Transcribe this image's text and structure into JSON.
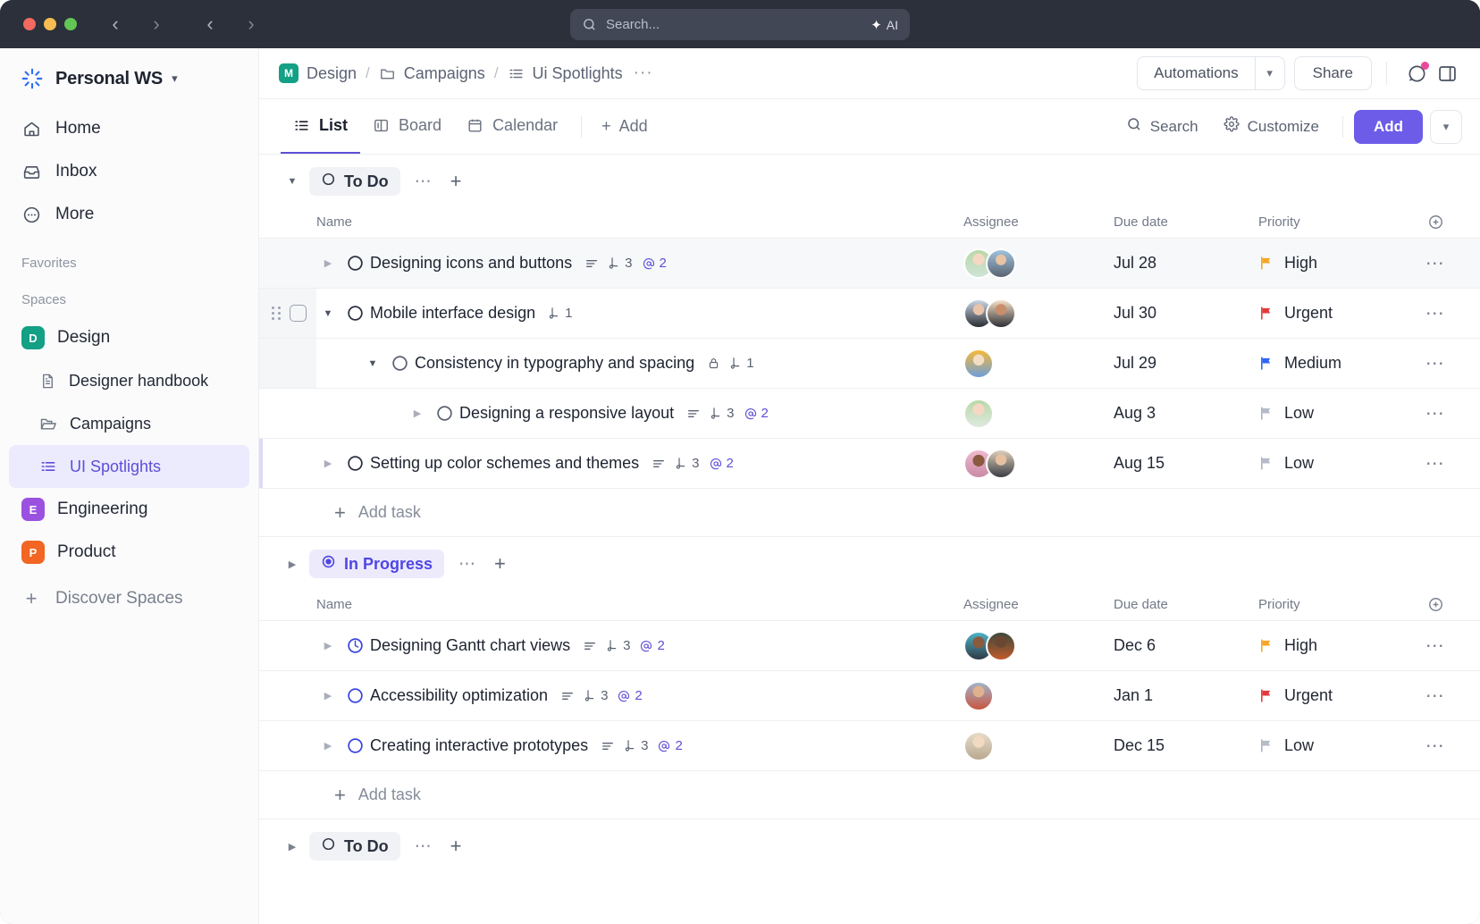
{
  "titlebar": {
    "search_placeholder": "Search...",
    "ai_label": "AI"
  },
  "sidebar": {
    "workspace": "Personal WS",
    "nav": [
      {
        "label": "Home",
        "icon": "home-icon"
      },
      {
        "label": "Inbox",
        "icon": "inbox-icon"
      },
      {
        "label": "More",
        "icon": "more-circle-icon"
      }
    ],
    "favorites_label": "Favorites",
    "spaces_label": "Spaces",
    "spaces": [
      {
        "label": "Design",
        "badge": "D",
        "color": "#13a085"
      },
      {
        "label": "Engineering",
        "badge": "E",
        "color": "#9b51e0"
      },
      {
        "label": "Product",
        "badge": "P",
        "color": "#f26522"
      }
    ],
    "design_children": [
      {
        "label": "Designer handbook",
        "icon": "doc-icon"
      },
      {
        "label": "Campaigns",
        "icon": "folder-open-icon"
      }
    ],
    "active_list": "UI Spotlights",
    "discover_label": "Discover Spaces"
  },
  "header": {
    "breadcrumb": [
      {
        "label": "Design",
        "badge": "M",
        "icon": "space-badge"
      },
      {
        "label": "Campaigns",
        "icon": "folder-icon"
      },
      {
        "label": "Ui Spotlights",
        "icon": "list-icon"
      }
    ],
    "separator": "/",
    "overflow": "···",
    "automations_label": "Automations",
    "share_label": "Share"
  },
  "viewbar": {
    "tabs": [
      {
        "label": "List",
        "icon": "list-icon",
        "active": true
      },
      {
        "label": "Board",
        "icon": "board-icon",
        "active": false
      },
      {
        "label": "Calendar",
        "icon": "calendar-icon",
        "active": false
      }
    ],
    "add_view_label": "Add",
    "search_label": "Search",
    "customize_label": "Customize",
    "add_label": "Add"
  },
  "columns": {
    "name": "Name",
    "assignee": "Assignee",
    "due_date": "Due date",
    "priority": "Priority"
  },
  "accent": "#6c5ce7",
  "groups": [
    {
      "status": "To Do",
      "status_type": "todo",
      "expanded": true,
      "add_task_label": "Add task",
      "tasks": [
        {
          "name": "Designing icons and buttons",
          "indent": 0,
          "status_icon": "circle-open",
          "has_description": true,
          "subtask_count": "3",
          "mention_count": "2",
          "locked": false,
          "expandable": true,
          "expanded": false,
          "assignees": [
            "#c9e2d2",
            "#7f94ae"
          ],
          "due_date": "Jul 28",
          "priority": "High",
          "priority_color": "#f5a623",
          "highlight": true
        },
        {
          "name": "Mobile interface design",
          "indent": 0,
          "status_icon": "circle-open",
          "has_description": false,
          "subtask_count": "1",
          "mention_count": "",
          "locked": false,
          "expandable": true,
          "expanded": true,
          "assignees": [
            "#cbd6e4",
            "#f2ddc9"
          ],
          "due_date": "Jul 30",
          "priority": "Urgent",
          "priority_color": "#e5383b",
          "highlight": false
        },
        {
          "name": "Consistency in typography and spacing",
          "indent": 1,
          "status_icon": "circle-open",
          "has_description": false,
          "subtask_count": "1",
          "mention_count": "",
          "locked": true,
          "expandable": true,
          "expanded": true,
          "assignees": [
            "#f6b93b"
          ],
          "due_date": "Jul 29",
          "priority": "Medium",
          "priority_color": "#2f66f6",
          "highlight": false
        },
        {
          "name": "Designing a responsive layout",
          "indent": 2,
          "status_icon": "circle-open",
          "has_description": true,
          "subtask_count": "3",
          "mention_count": "2",
          "locked": false,
          "expandable": true,
          "expanded": false,
          "assignees": [
            "#cfe3cf"
          ],
          "due_date": "Aug 3",
          "priority": "Low",
          "priority_color": "#a9b0bd",
          "highlight": false
        },
        {
          "name": "Setting up color schemes and themes",
          "indent": 0,
          "status_icon": "circle-open",
          "has_description": true,
          "subtask_count": "3",
          "mention_count": "2",
          "locked": false,
          "expandable": true,
          "expanded": false,
          "assignees": [
            "#e9b3c9",
            "#d8c0a8"
          ],
          "due_date": "Aug 15",
          "priority": "Low",
          "priority_color": "#a9b0bd",
          "highlight": false
        }
      ]
    },
    {
      "status": "In Progress",
      "status_type": "progress",
      "expanded": false,
      "add_task_label": "Add task",
      "tasks": [
        {
          "name": "Designing Gantt chart views",
          "indent": 0,
          "status_icon": "circle-progress",
          "has_description": true,
          "subtask_count": "3",
          "mention_count": "2",
          "locked": false,
          "expandable": true,
          "expanded": false,
          "assignees": [
            "#4fb3c8",
            "#8a5a3b"
          ],
          "due_date": "Dec 6",
          "priority": "High",
          "priority_color": "#f5a623",
          "highlight": false
        },
        {
          "name": "Accessibility optimization",
          "indent": 0,
          "status_icon": "circle-blue",
          "has_description": true,
          "subtask_count": "3",
          "mention_count": "2",
          "locked": false,
          "expandable": true,
          "expanded": false,
          "assignees": [
            "#dfe3ea"
          ],
          "due_date": "Jan 1",
          "priority": "Urgent",
          "priority_color": "#e5383b",
          "highlight": false
        },
        {
          "name": "Creating interactive prototypes",
          "indent": 0,
          "status_icon": "circle-blue",
          "has_description": true,
          "subtask_count": "3",
          "mention_count": "2",
          "locked": false,
          "expandable": true,
          "expanded": false,
          "assignees": [
            "#e6dccb"
          ],
          "due_date": "Dec 15",
          "priority": "Low",
          "priority_color": "#a9b0bd",
          "highlight": false
        }
      ]
    },
    {
      "status": "To Do",
      "status_type": "todo",
      "expanded": false,
      "add_task_label": "Add task",
      "tasks": []
    }
  ]
}
